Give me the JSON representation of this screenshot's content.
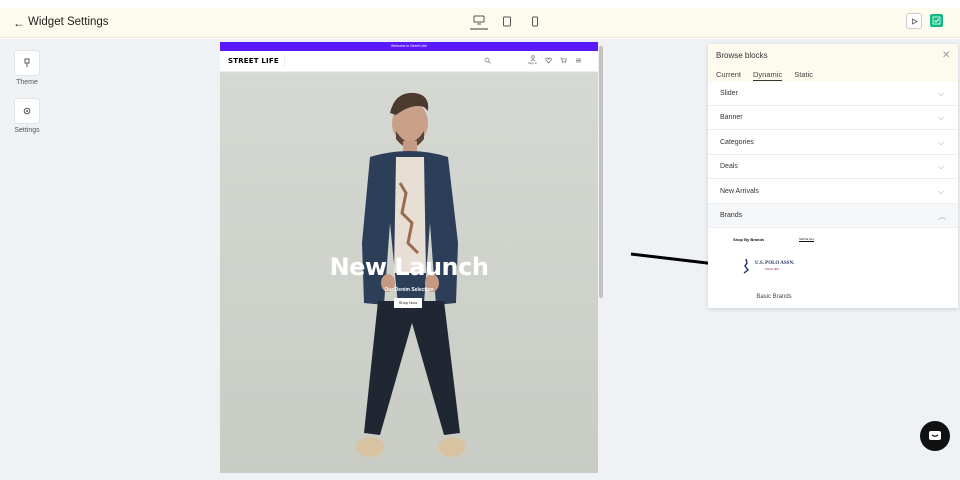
{
  "header": {
    "back_icon": "arrow-left-icon",
    "title": "Widget Settings",
    "devices": [
      "desktop-icon",
      "tablet-icon",
      "mobile-icon"
    ],
    "active_device": "desktop"
  },
  "sidebar": {
    "tools": [
      {
        "label": "Theme",
        "icon": "paint-brush-icon"
      },
      {
        "label": "Settings",
        "icon": "gear-icon"
      }
    ]
  },
  "preview": {
    "announcement": "Welcome to Street Life!",
    "logo": "STREET LIFE",
    "signin_label": "Sign in",
    "hero_title": "New Launch",
    "hero_subtitle": "Our Denim Selection",
    "cta": "Shop Now",
    "accent": "#5a18ff"
  },
  "panel": {
    "title": "Browse blocks",
    "tabs": [
      "Current",
      "Dynamic",
      "Static"
    ],
    "active_tab": "Dynamic",
    "sections": [
      "Slider",
      "Banner",
      "Categories",
      "Deals",
      "New Arrivals",
      "Brands"
    ],
    "expanded": "Brands",
    "brand_card": {
      "heading": "Shop By Brands",
      "show_all": "SHOW ALL",
      "logo_text": "U.S. POLO ASSN.",
      "logo_since": "SINCE 1890"
    },
    "block_caption": "Basic Brands"
  },
  "colors": {
    "header_bg": "#fdfaee",
    "workspace_bg": "#eff2f5",
    "save_green": "#10b981"
  }
}
